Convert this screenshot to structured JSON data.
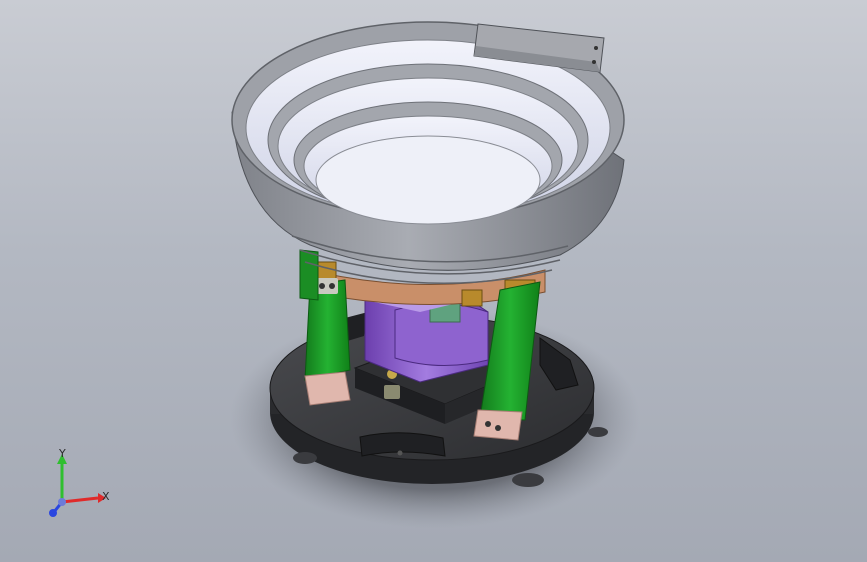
{
  "viewport": {
    "background_top": "#c9ccd3",
    "background_bottom": "#a4a9b4"
  },
  "model": {
    "bowl_color": "#9ea1a8",
    "bowl_inner_color": "#e3e6f4",
    "base_color": "#3a3b3e",
    "spring_leg_color": "#1e9a2a",
    "magnet_color": "#9b6ed6",
    "clamp_color": "#b88a2c",
    "foot_pad_color": "#e0b7ad",
    "chute_color": "#a6a8ae"
  },
  "triad": {
    "x_label": "X",
    "y_label": "Y",
    "x_color": "#e02a2a",
    "y_color": "#2fbf2f",
    "z_color": "#2a46e0"
  }
}
